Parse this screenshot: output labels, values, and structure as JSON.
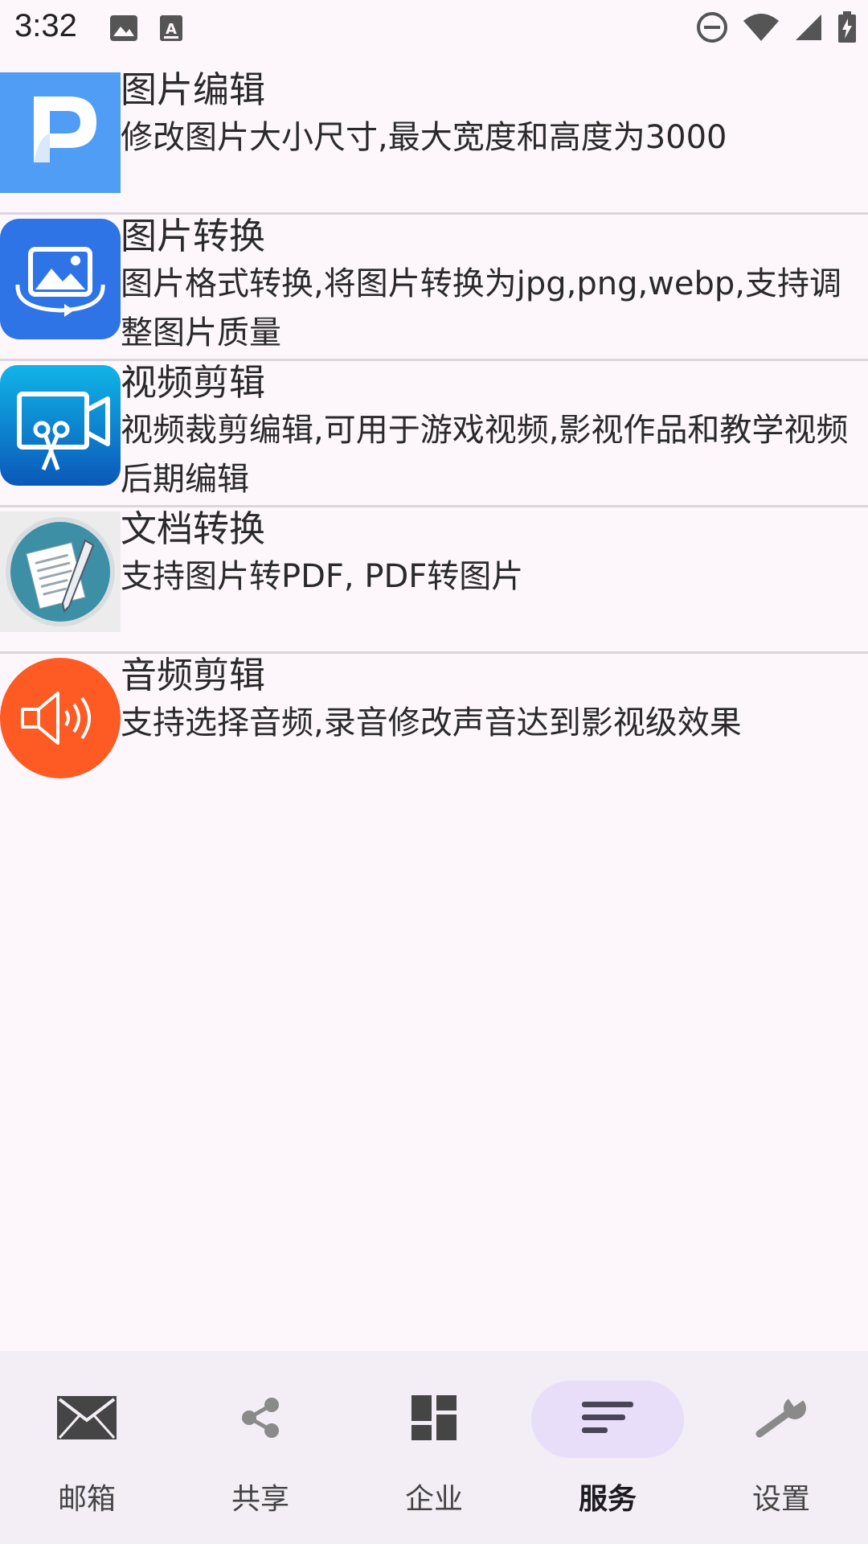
{
  "status_bar": {
    "time": "3:32",
    "left_icons": [
      "image-notification-icon",
      "font-notification-icon"
    ],
    "right_icons": [
      "do-not-disturb-icon",
      "wifi-icon",
      "cellular-signal-icon",
      "battery-charging-icon"
    ]
  },
  "services": [
    {
      "icon": "photo-edit-icon",
      "title": "图片编辑",
      "description": "修改图片大小尺寸,最大宽度和高度为3000"
    },
    {
      "icon": "image-convert-icon",
      "title": "图片转换",
      "description": "图片格式转换,将图片转换为jpg,png,webp,支持调整图片质量"
    },
    {
      "icon": "video-edit-icon",
      "title": "视频剪辑",
      "description": "视频裁剪编辑,可用于游戏视频,影视作品和教学视频后期编辑"
    },
    {
      "icon": "document-convert-icon",
      "title": "文档转换",
      "description": "支持图片转PDF, PDF转图片"
    },
    {
      "icon": "audio-edit-icon",
      "title": "音频剪辑",
      "description": "支持选择音频,录音修改声音达到影视级效果"
    }
  ],
  "bottom_nav": {
    "active": "服务",
    "items": [
      {
        "label": "邮箱",
        "icon": "mail-icon"
      },
      {
        "label": "共享",
        "icon": "share-icon"
      },
      {
        "label": "企业",
        "icon": "dashboard-icon"
      },
      {
        "label": "服务",
        "icon": "short-text-icon"
      },
      {
        "label": "设置",
        "icon": "wrench-icon"
      }
    ]
  },
  "colors": {
    "background": "#fdf7fc",
    "nav_background": "#f3edf5",
    "nav_active_pill": "#e9defa",
    "divider": "#dcd6dc",
    "audio_icon": "#fd5a24",
    "photo_edit_icon": "#4f9df5"
  }
}
